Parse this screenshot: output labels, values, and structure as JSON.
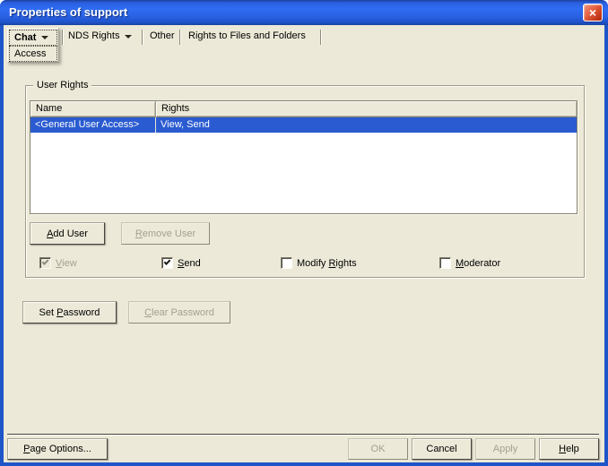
{
  "window": {
    "title": "Properties of support",
    "close_icon": "×"
  },
  "tabs": {
    "current_tab": {
      "label": "Chat",
      "has_dropdown": true
    },
    "current_page": {
      "label": "Access"
    },
    "others": [
      {
        "label": "NDS Rights",
        "has_dropdown": true
      },
      {
        "label": "Other",
        "has_dropdown": false
      },
      {
        "label": "Rights to Files and Folders",
        "has_dropdown": false
      }
    ]
  },
  "user_rights": {
    "group_label": "User Rights",
    "table": {
      "columns": [
        "Name",
        "Rights"
      ],
      "rows": [
        {
          "name": "<General User Access>",
          "rights": "View, Send",
          "selected": true
        }
      ]
    },
    "add_user": {
      "pre": "",
      "key": "A",
      "post": "dd User",
      "enabled": true
    },
    "remove_user": {
      "pre": "",
      "key": "R",
      "post": "emove User",
      "enabled": false
    },
    "checkboxes": [
      {
        "pre": "",
        "key": "V",
        "post": "iew",
        "checked": true,
        "enabled": false
      },
      {
        "pre": "",
        "key": "S",
        "post": "end",
        "checked": true,
        "enabled": true
      },
      {
        "pre": "Modify ",
        "key": "R",
        "post": "ights",
        "checked": false,
        "enabled": true
      },
      {
        "pre": "",
        "key": "M",
        "post": "oderator",
        "checked": false,
        "enabled": true
      }
    ]
  },
  "password": {
    "set_password": {
      "pre": "Set ",
      "key": "P",
      "post": "assword",
      "enabled": true
    },
    "clear_password": {
      "pre": "",
      "key": "C",
      "post": "lear Password",
      "enabled": false
    }
  },
  "footer": {
    "page_options": {
      "pre": "",
      "key": "P",
      "post": "age Options...",
      "enabled": true
    },
    "ok": {
      "label": "OK",
      "enabled": false
    },
    "cancel": {
      "label": "Cancel",
      "enabled": true
    },
    "apply": {
      "label": "Apply",
      "enabled": false
    },
    "help": {
      "pre": "",
      "key": "H",
      "post": "elp",
      "enabled": true
    }
  },
  "colors": {
    "dialog_bg": "#ece9d8",
    "selection_blue": "#2a5bd0",
    "titlebar_blue": "#2f6cf2",
    "window_border_blue": "#1e55c8",
    "close_red": "#c33517"
  }
}
